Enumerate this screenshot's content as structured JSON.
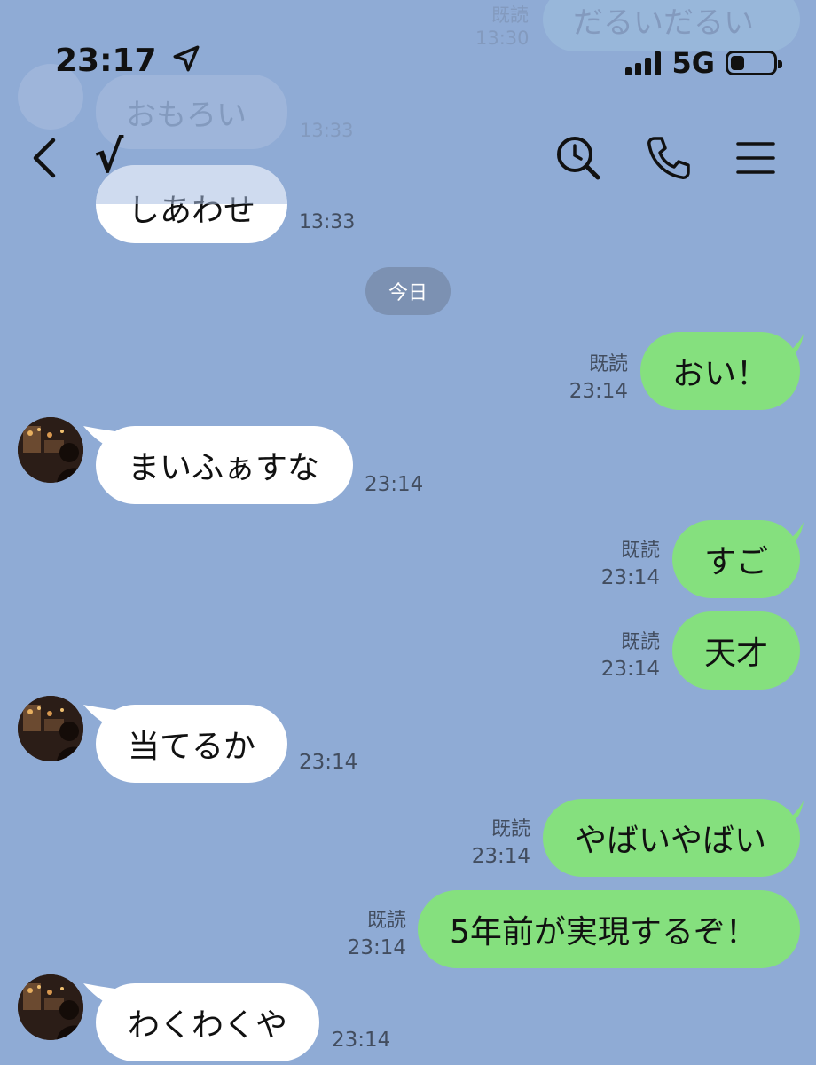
{
  "status_bar": {
    "time": "23:17",
    "network": "5G"
  },
  "header": {
    "title": "√"
  },
  "ghost_messages": [
    {
      "side": "sent",
      "text": "だるいだるい",
      "read": "既読",
      "time": "13:30"
    },
    {
      "side": "recv",
      "text": "おもろい",
      "time": "13:33"
    },
    {
      "side": "recv",
      "text": "しあわせ",
      "time": "13:33"
    }
  ],
  "date_separator": "今日",
  "messages": [
    {
      "side": "sent",
      "text": "おい！",
      "read": "既読",
      "time": "23:14"
    },
    {
      "side": "recv",
      "text": "まいふぁすな",
      "time": "23:14"
    },
    {
      "side": "sent",
      "text": "すご",
      "read": "既読",
      "time": "23:14"
    },
    {
      "side": "sent",
      "text": "天才",
      "read": "既読",
      "time": "23:14"
    },
    {
      "side": "recv",
      "text": "当てるか",
      "time": "23:14"
    },
    {
      "side": "sent",
      "text": "やばいやばい",
      "read": "既読",
      "time": "23:14"
    },
    {
      "side": "sent",
      "text": "5年前が実現するぞ！",
      "read": "既読",
      "time": "23:14"
    },
    {
      "side": "recv",
      "text": "わくわくや",
      "time": "23:14"
    }
  ],
  "colors": {
    "background": "#8fabd5",
    "sent_bubble": "#85e07e",
    "received_bubble": "#ffffff",
    "date_pill": "#7c91b2"
  },
  "icons": [
    "location-arrow-icon",
    "signal-icon",
    "battery-icon",
    "back-chevron-icon",
    "search-icon",
    "phone-icon",
    "menu-icon"
  ]
}
